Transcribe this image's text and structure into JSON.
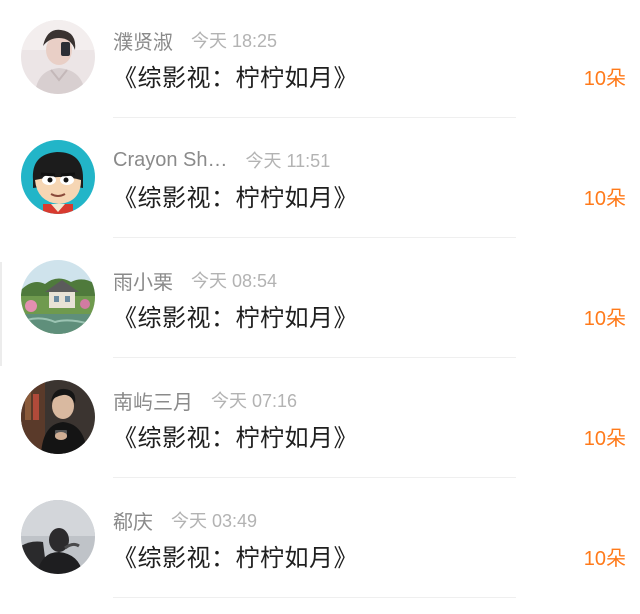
{
  "colors": {
    "name": "#8a8a8a",
    "time": "#b3b3b3",
    "message": "#1f1f1f",
    "count": "#ff7a1a",
    "divider": "#efefef"
  },
  "items": [
    {
      "name": "濮贤淑",
      "time": "今天 18:25",
      "message": "《综影视：柠柠如月》",
      "count": "10朵",
      "avatar_icon": "person-photo-avatar"
    },
    {
      "name": "Crayon Sh…",
      "time": "今天 11:51",
      "message": "《综影视：柠柠如月》",
      "count": "10朵",
      "avatar_icon": "cartoon-boy-avatar"
    },
    {
      "name": "雨小栗",
      "time": "今天 08:54",
      "message": "《综影视：柠柠如月》",
      "count": "10朵",
      "avatar_icon": "landscape-house-avatar"
    },
    {
      "name": "南屿三月",
      "time": "今天 07:16",
      "message": "《综影视：柠柠如月》",
      "count": "10朵",
      "avatar_icon": "person-photo-avatar"
    },
    {
      "name": "郗庆",
      "time": "今天 03:49",
      "message": "《综影视：柠柠如月》",
      "count": "10朵",
      "avatar_icon": "person-silhouette-avatar"
    }
  ]
}
